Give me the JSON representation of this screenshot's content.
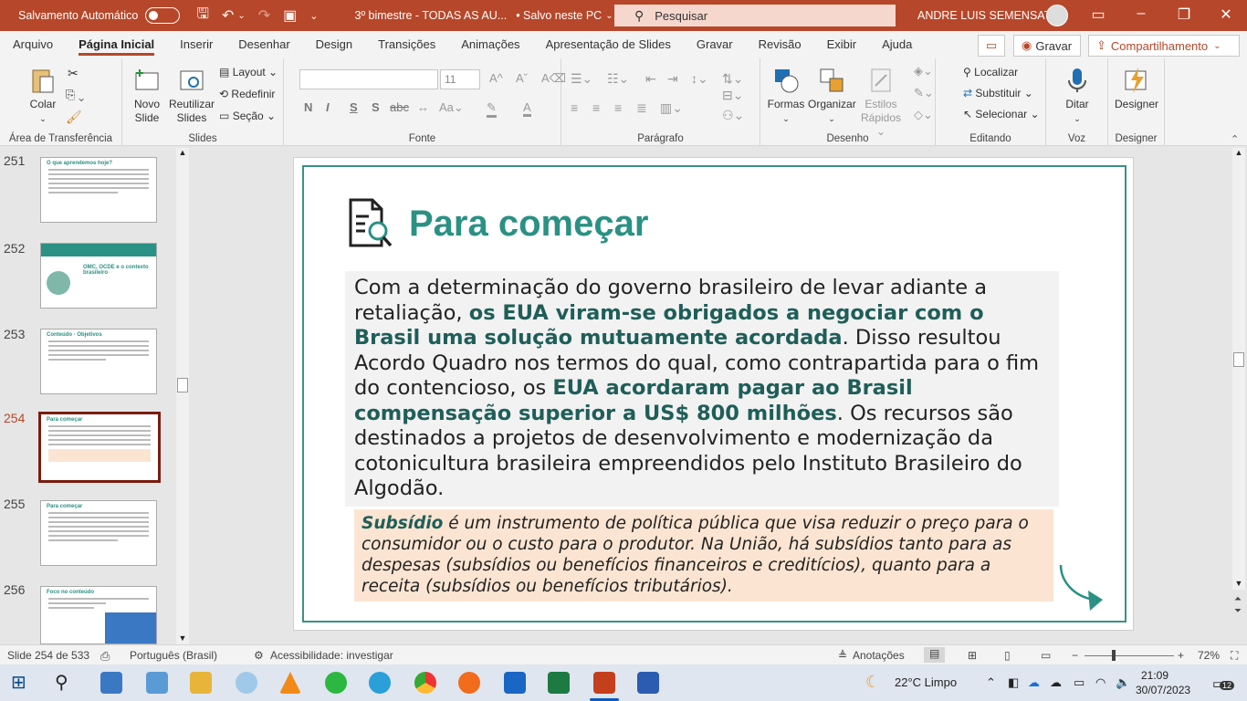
{
  "titlebar": {
    "autosave": "Salvamento Automático",
    "doc": "3º bimestre - TODAS AS AU...",
    "saved": "• Salvo neste PC",
    "search": "Pesquisar",
    "user": "ANDRE LUIS SEMENSATO"
  },
  "tabs": [
    "Arquivo",
    "Página Inicial",
    "Inserir",
    "Desenhar",
    "Design",
    "Transições",
    "Animações",
    "Apresentação de Slides",
    "Gravar",
    "Revisão",
    "Exibir",
    "Ajuda"
  ],
  "tab_right": {
    "record": "Gravar",
    "share": "Compartilhamento"
  },
  "ribbon": {
    "clipboard": {
      "label": "Área de Transferência",
      "paste": "Colar"
    },
    "slides": {
      "label": "Slides",
      "new": "Novo",
      "new2": "Slide",
      "reuse": "Reutilizar",
      "reuse2": "Slides",
      "layout": "Layout",
      "reset": "Redefinir",
      "section": "Seção"
    },
    "font": {
      "label": "Fonte",
      "size": "11",
      "bold": "N",
      "italic": "I",
      "underline": "S",
      "shadow": "S",
      "strike": "abc"
    },
    "paragraph": {
      "label": "Parágrafo"
    },
    "drawing": {
      "label": "Desenho",
      "shapes": "Formas",
      "arrange": "Organizar",
      "styles": "Estilos",
      "styles2": "Rápidos"
    },
    "editing": {
      "label": "Editando",
      "find": "Localizar",
      "replace": "Substituir",
      "select": "Selecionar"
    },
    "voice": {
      "label": "Voz",
      "dictate": "Ditar"
    },
    "designer": {
      "label": "Designer",
      "btn": "Designer"
    }
  },
  "thumbnails": [
    {
      "num": "251",
      "title": "O que aprendemos hoje?"
    },
    {
      "num": "252",
      "title": "OMC, OCDE e o contexto brasileiro"
    },
    {
      "num": "253",
      "title": "Conteúdo · Objetivos"
    },
    {
      "num": "254",
      "title": "Para começar"
    },
    {
      "num": "255",
      "title": "Para começar"
    },
    {
      "num": "256",
      "title": "Foco no conteúdo"
    }
  ],
  "slide": {
    "title": "Para começar",
    "p1": "Com a determinação do governo brasileiro de levar adiante a retaliação, ",
    "h1": "os EUA viram-se obrigados a negociar com o Brasil uma solução mutuamente acordada",
    "p2": ". Disso resultou Acordo Quadro nos termos do qual, como contrapartida para o fim do contencioso, os ",
    "h2": "EUA acordaram pagar ao Brasil compensação superior a US$ 800 milhões",
    "p3": ". Os recursos são destinados a projetos de desenvolvimento e modernização da cotonicultura brasileira empreendidos pelo Instituto Brasileiro do Algodão.",
    "note_term": "Subsídio",
    "note_text": " é um instrumento de política pública que visa reduzir o preço para o consumidor ou o custo para o produtor. Na União, há subsídios tanto para as despesas (subsídios ou benefícios financeiros e creditícios), quanto para a receita (subsídios ou benefícios tributários)."
  },
  "status": {
    "slide": "Slide 254 de 533",
    "lang": "Português (Brasil)",
    "access": "Acessibilidade: investigar",
    "notes": "Anotações",
    "zoom": "72%"
  },
  "taskbar": {
    "weather": "22°C  Limpo",
    "time": "21:09",
    "date": "30/07/2023",
    "badge": "12"
  },
  "colors": {
    "brand": "#b7472a",
    "accent": "#2a9184",
    "highlight": "#1f5e59",
    "note_bg": "#fbe5d2"
  }
}
